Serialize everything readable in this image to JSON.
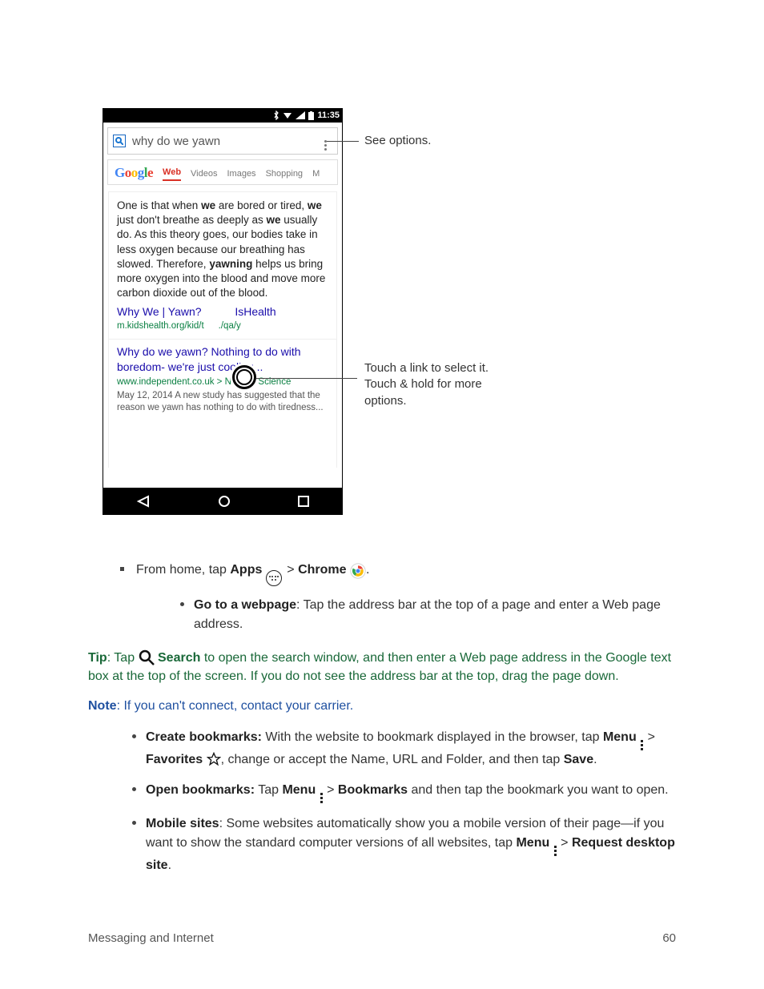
{
  "phone": {
    "time": "11:35",
    "query": "why do we yawn",
    "logo": {
      "g1": "G",
      "o1": "o",
      "o2": "o",
      "g2": "g",
      "l": "l",
      "e": "e"
    },
    "tabs": {
      "web": "Web",
      "videos": "Videos",
      "images": "Images",
      "shopping": "Shopping",
      "more": "M"
    },
    "snippet": {
      "p1a": "One is that when ",
      "we1": "we",
      "p1b": " are bored or tired, ",
      "we2": "we",
      "p1c": " just don't breathe as deeply as ",
      "we3": "we",
      "p1d": " usually do. As this theory goes, our bodies take in less oxygen because our breathing has slowed. Therefore, ",
      "yawn": "yawning",
      "p1e": " helps us bring more oxygen into the blood and move more carbon dioxide out of the blood."
    },
    "result1": {
      "title_a": "Why We | Yawn?",
      "title_b": "IsHealth",
      "cite_a": "m.kidshealth.org/kid/t",
      "cite_b": "./qa/y"
    },
    "result2": {
      "title_a": "Why do we yawn?",
      "title_b": " Nothing to do with boredom- we're just cooling...",
      "cite": "www.independent.co.uk > News > Science",
      "snip": "May 12, 2014  A new study has suggested that the reason we yawn has nothing to do with tiredness..."
    }
  },
  "callouts": {
    "options": "See options.",
    "link": "Touch a link to select it. Touch & hold for more options."
  },
  "body": {
    "from_home_a": "From home, tap ",
    "apps": "Apps",
    "gt1": " > ",
    "chrome": "Chrome",
    "period": ".",
    "goto_b": "Go to a webpage",
    "goto_t": ": Tap the address bar at the top of a page and enter a Web page address.",
    "tip_b": "Tip",
    "tip_t1": ": Tap ",
    "tip_search": "Search",
    "tip_t2": " to open the search window, and then enter a Web page address in the Google text box at the top of the screen. If you do not see the address bar at the top, drag the page down.",
    "note_b": "Note",
    "note_t": ": If you can't connect, contact your carrier.",
    "cb_b": "Create bookmarks:",
    "cb_t1": " With the website to bookmark displayed in the browser, tap ",
    "menu": "Menu",
    "cb_gt": "  > ",
    "fav": "Favorites",
    "cb_t2": ", change or accept the Name, URL and Folder, and then tap ",
    "save": "Save",
    "cb_t3": ".",
    "ob_b": "Open bookmarks:",
    "ob_t1": " Tap ",
    "ob_gt": "  > ",
    "bm": "Bookmarks",
    "ob_t2": " and then tap the bookmark you want to open.",
    "ms_b": "Mobile sites",
    "ms_t1": ": Some websites automatically show you a mobile version of their page—if you want to show the standard computer versions of all websites, tap ",
    "ms_gt": "  > ",
    "rds": "Request desktop site",
    "ms_t2": "."
  },
  "footer": {
    "section": "Messaging and Internet",
    "page": "60"
  }
}
